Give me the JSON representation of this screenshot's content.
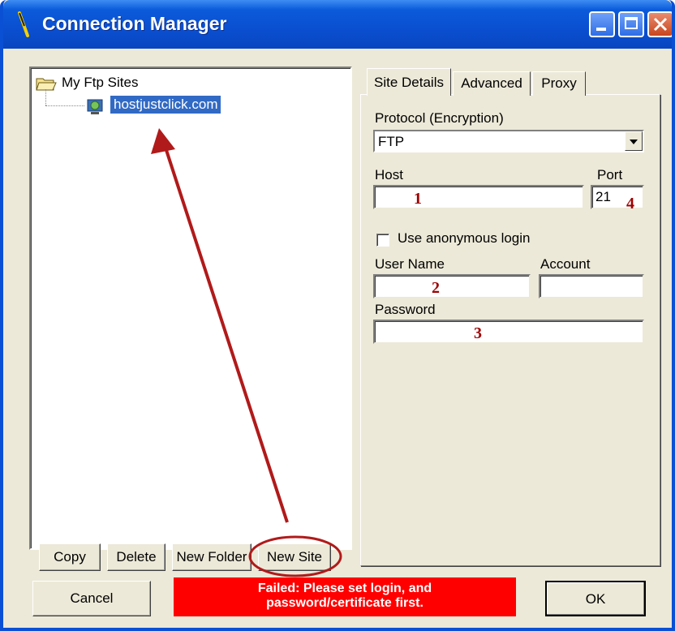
{
  "window": {
    "title": "Connection Manager",
    "icons": [
      "app-icon",
      "minimize-icon",
      "maximize-icon",
      "close-icon"
    ]
  },
  "tree": {
    "root_label": "My Ftp Sites",
    "site_label": "hostjustclick.com"
  },
  "left_buttons": {
    "copy": "Copy",
    "delete": "Delete",
    "new_folder": "New Folder",
    "new_site": "New Site"
  },
  "tabs": [
    "Site Details",
    "Advanced",
    "Proxy"
  ],
  "site_details": {
    "protocol_label": "Protocol (Encryption)",
    "protocol_value": "FTP",
    "host_label": "Host",
    "host_value": "",
    "port_label": "Port",
    "port_value": "21",
    "anonymous_label": "Use anonymous login",
    "user_label": "User Name",
    "account_label": "Account",
    "password_label": "Password"
  },
  "annotations": {
    "n1": "1",
    "n2": "2",
    "n3": "3",
    "n4": "4"
  },
  "footer": {
    "cancel": "Cancel",
    "ok": "OK",
    "error_line1": "Failed: Please set login, and",
    "error_line2": "password/certificate first."
  },
  "colors": {
    "titlebar": "#0A4FD0",
    "error_bg": "#FF0000",
    "annotation": "#B11A1A",
    "selection": "#316AC5"
  }
}
